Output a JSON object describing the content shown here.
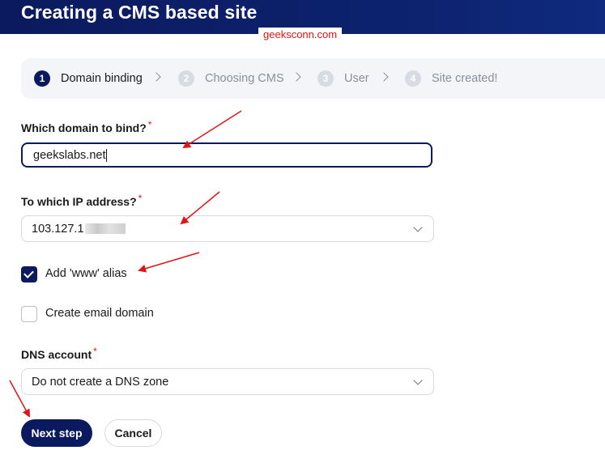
{
  "header": {
    "title": "Creating a CMS based site"
  },
  "watermark": "geeksconn.com",
  "steps": [
    {
      "number": "1",
      "label": "Domain binding",
      "active": true
    },
    {
      "number": "2",
      "label": "Choosing CMS",
      "active": false
    },
    {
      "number": "3",
      "label": "User",
      "active": false
    },
    {
      "number": "4",
      "label": "Site created!",
      "active": false
    }
  ],
  "form": {
    "domain": {
      "label": "Which domain to bind?",
      "required_mark": "*",
      "value": "geekslabs.net"
    },
    "ip": {
      "label": "To which IP address?",
      "required_mark": "*",
      "value": "103.127.1"
    },
    "www_alias": {
      "label": "Add 'www' alias",
      "checked": true
    },
    "email_domain": {
      "label": "Create email domain",
      "checked": false
    },
    "dns": {
      "label": "DNS account",
      "required_mark": "*",
      "value": "Do not create a DNS zone"
    }
  },
  "buttons": {
    "next": "Next step",
    "cancel": "Cancel"
  },
  "colors": {
    "brand": "#0b1a5e",
    "required": "#e01414",
    "annotation": "#e01414"
  }
}
